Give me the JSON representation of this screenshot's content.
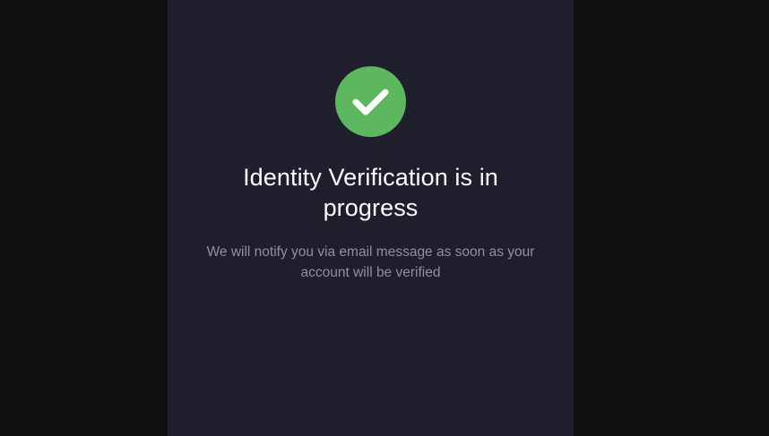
{
  "verification": {
    "status_icon": "checkmark-circle-icon",
    "title": "Identity Verification is in progress",
    "message": "We will notify you via email message as soon as your account will be verified"
  },
  "colors": {
    "outer_background": "#0f0f10",
    "panel_background": "#1e1f2b",
    "success_green": "#5cb85f",
    "title_text": "#ffffff",
    "message_text": "#8f909a"
  }
}
